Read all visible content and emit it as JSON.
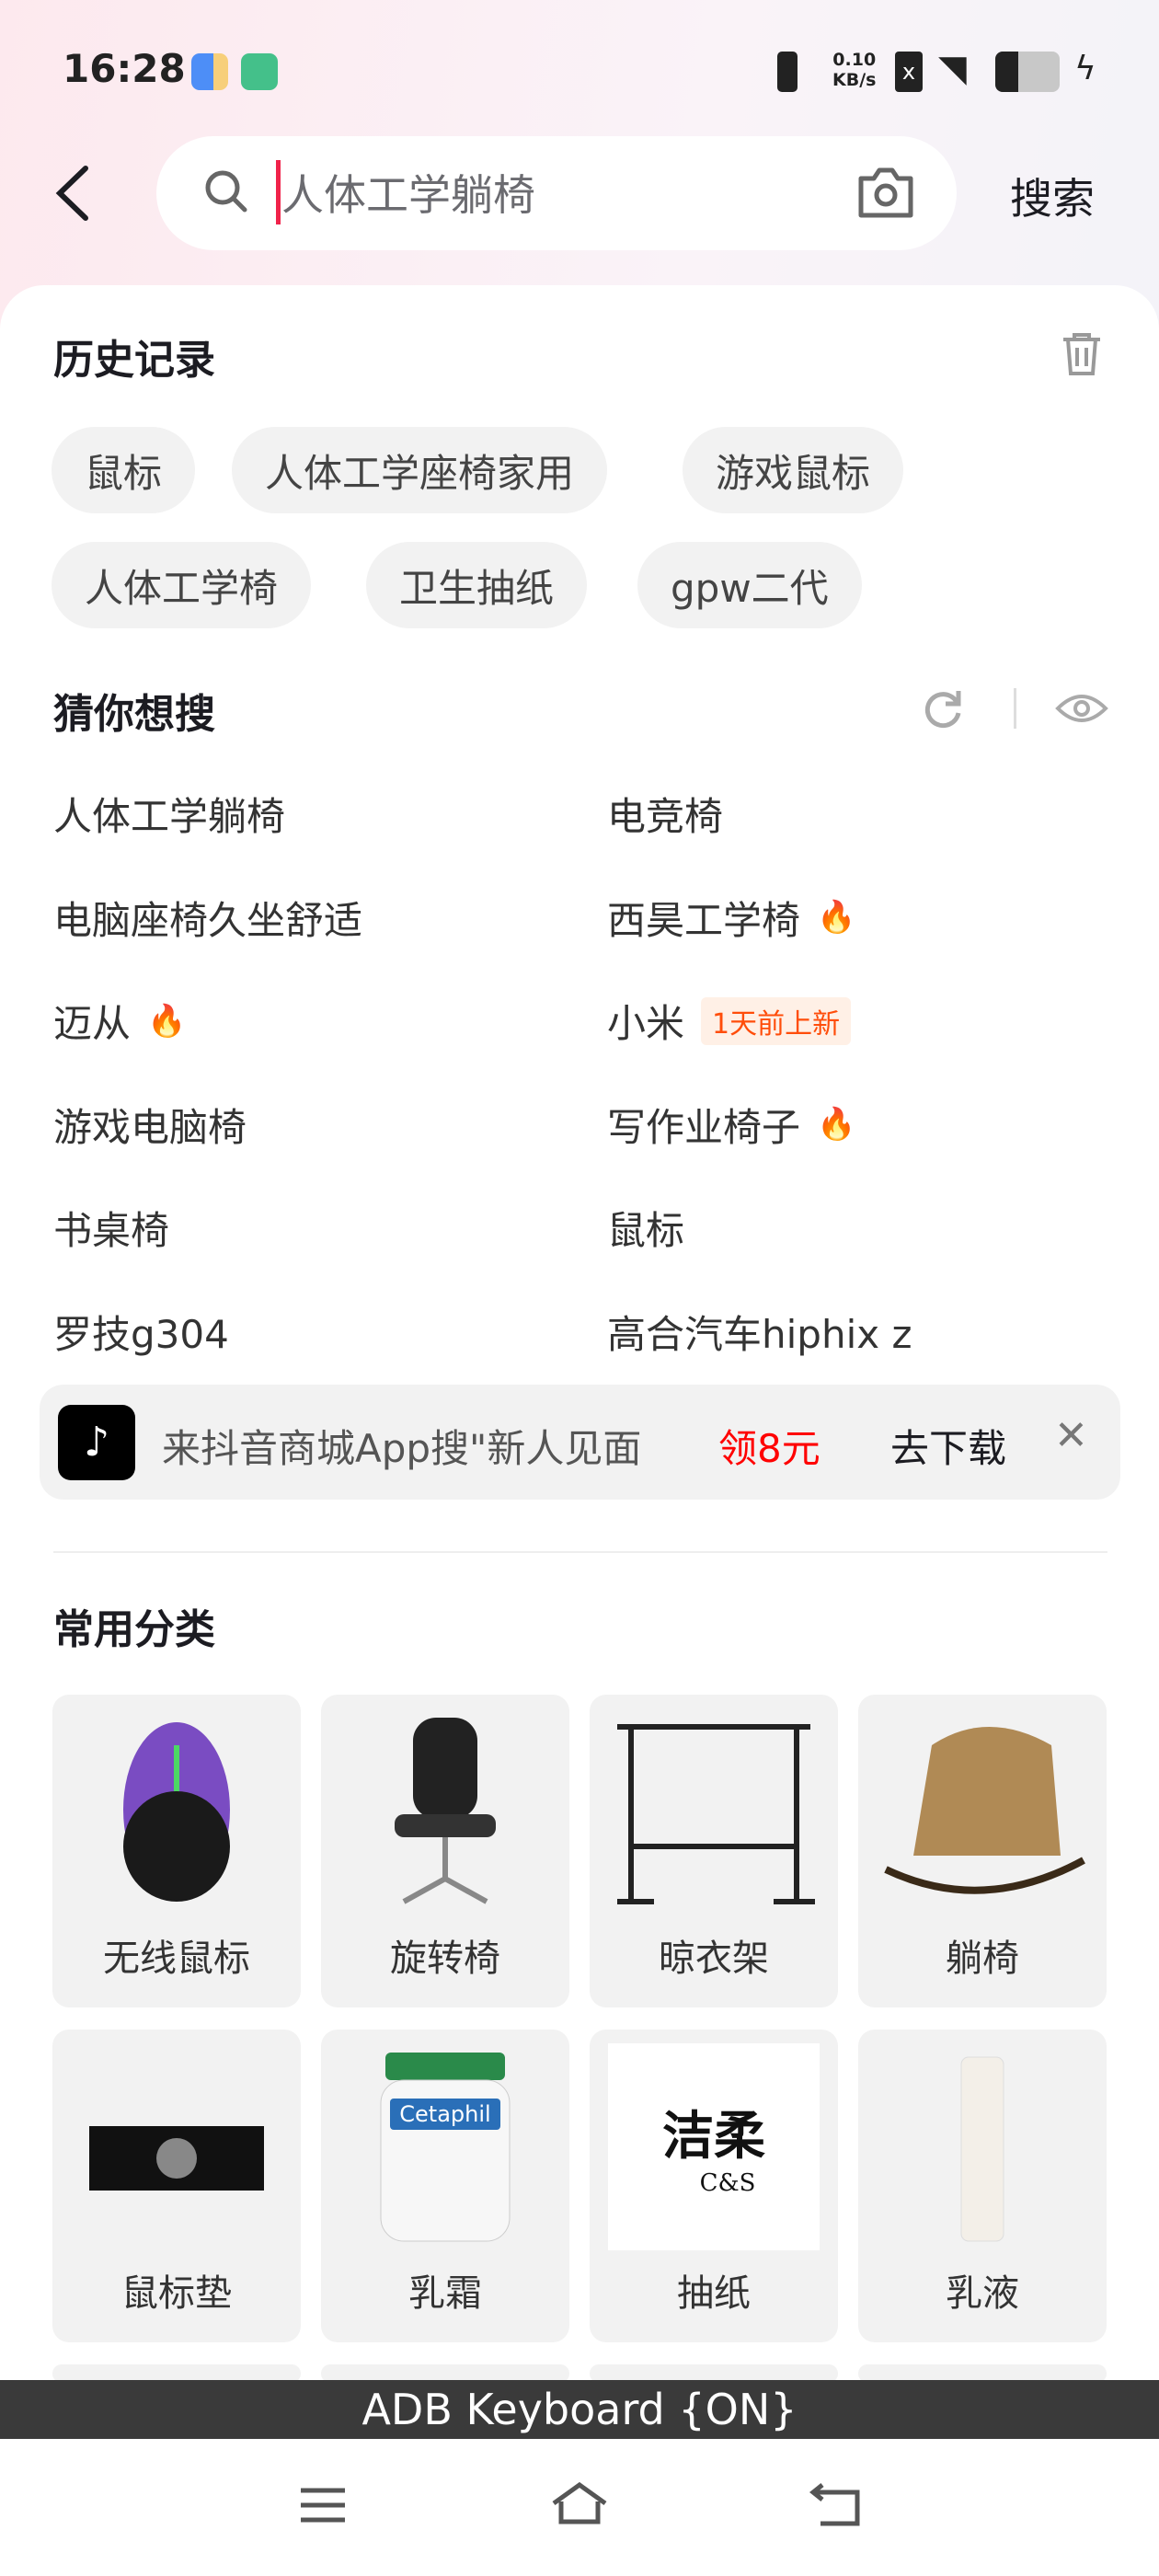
{
  "status_bar": {
    "time": "16:28",
    "net_speed_value": "0.10",
    "net_speed_unit": "KB/s",
    "battery_level": 0.35
  },
  "header": {
    "search_value": "人体工学躺椅",
    "search_button": "搜索"
  },
  "history": {
    "title": "历史记录",
    "items": [
      "鼠标",
      "人体工学座椅家用",
      "游戏鼠标",
      "人体工学椅",
      "卫生抽纸",
      "gpw二代"
    ]
  },
  "suggest": {
    "title": "猜你想搜",
    "items": [
      {
        "label": "人体工学躺椅"
      },
      {
        "label": "电竞椅"
      },
      {
        "label": "电脑座椅久坐舒适"
      },
      {
        "label": "西昊工学椅",
        "hot": true
      },
      {
        "label": "迈从",
        "hot": true
      },
      {
        "label": "小米",
        "tag": "1天前上新"
      },
      {
        "label": "游戏电脑椅"
      },
      {
        "label": "写作业椅子",
        "hot": true
      },
      {
        "label": "书桌椅"
      },
      {
        "label": "鼠标"
      },
      {
        "label": "罗技g304"
      },
      {
        "label": "高合汽车hiphix z"
      }
    ]
  },
  "banner": {
    "text": "来抖音商城App搜\"新人见面",
    "reward": "领8元",
    "action": "去下载",
    "reward_color": "#ff0000"
  },
  "categories": {
    "title": "常用分类",
    "items": [
      "无线鼠标",
      "旋转椅",
      "晾衣架",
      "躺椅",
      "鼠标垫",
      "乳霜",
      "抽纸",
      "乳液"
    ],
    "logo_texts": [
      "Cetaphil",
      "洁柔 C&S"
    ]
  },
  "keyboard_bar": "ADB Keyboard {ON}"
}
